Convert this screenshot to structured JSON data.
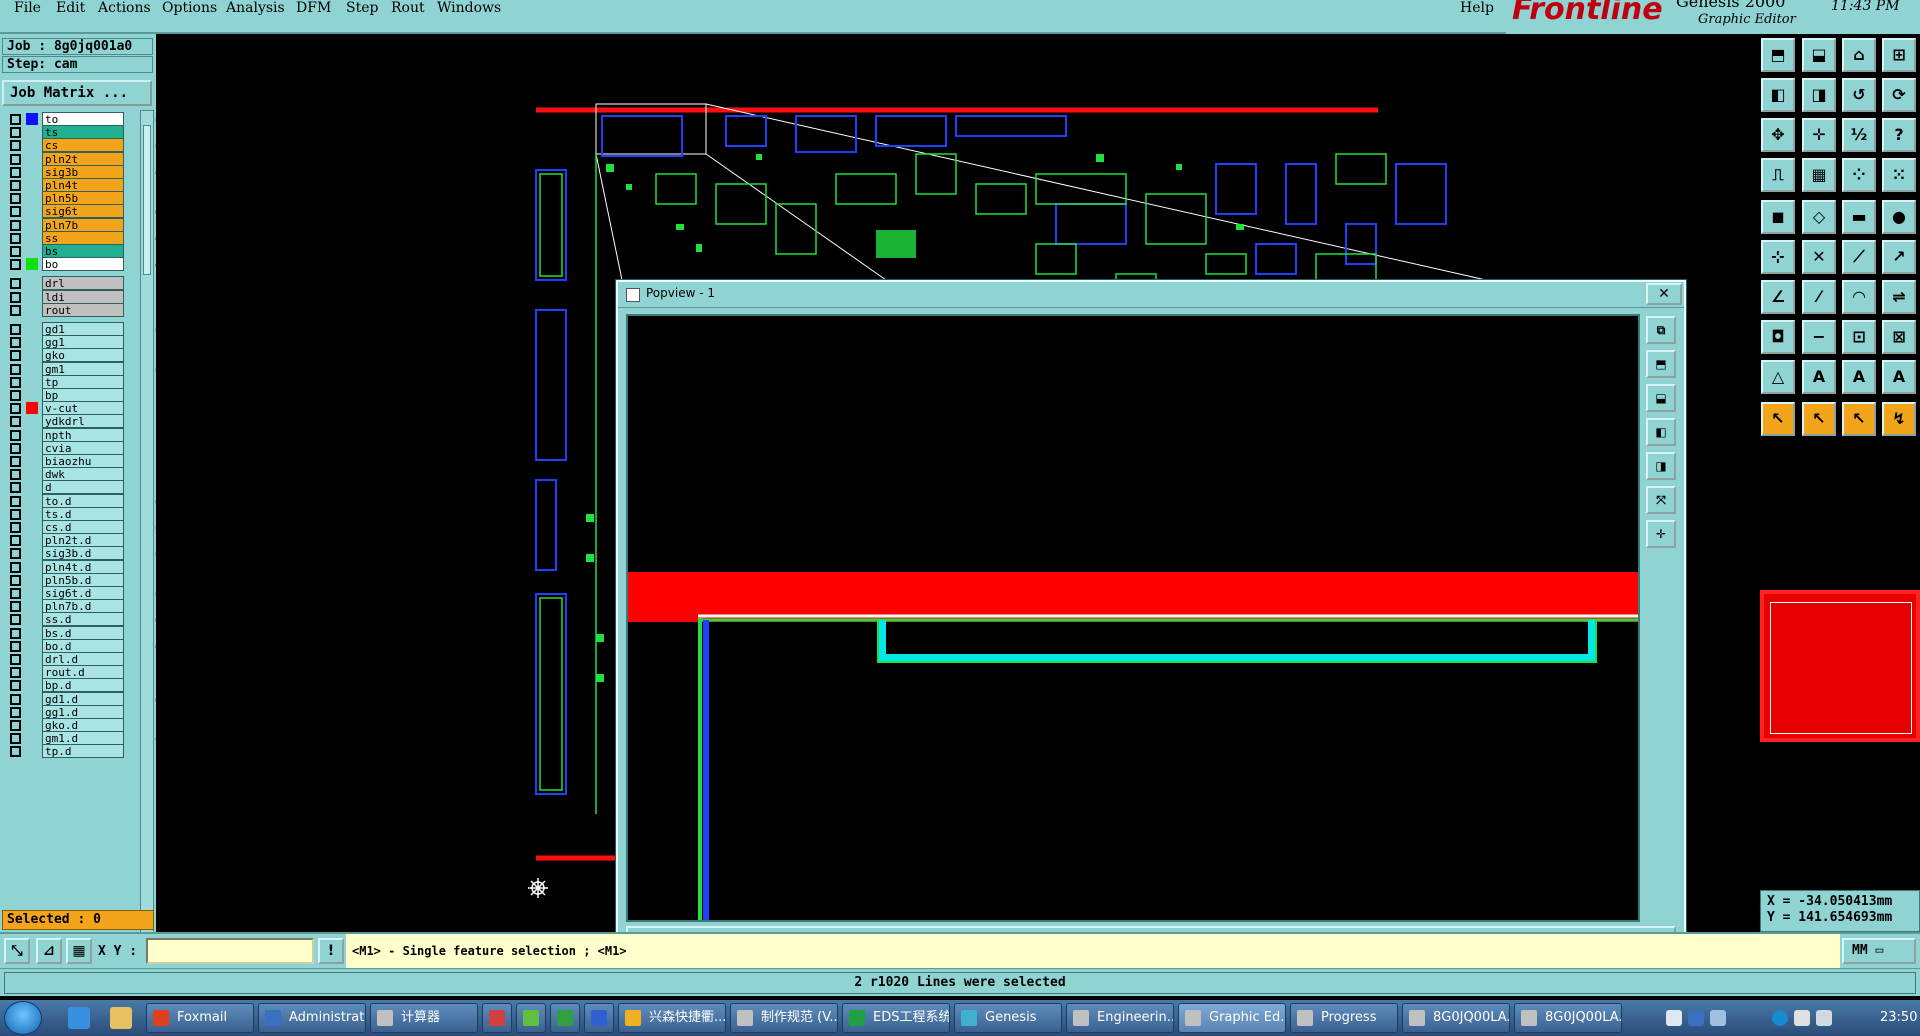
{
  "menu": {
    "items": [
      "File",
      "Edit",
      "Actions",
      "Options",
      "Analysis",
      "DFM",
      "Step",
      "Rout",
      "Windows"
    ],
    "help": "Help"
  },
  "brand": {
    "logo": "Frontline",
    "product": "Genesis 2000",
    "subtitle": "Graphic Editor",
    "time": "11:43 PM"
  },
  "job": {
    "job_label": "Job : 8g0jq001a0",
    "step_label": "Step: cam",
    "matrix_button": "Job Matrix ..."
  },
  "layers": [
    {
      "name": "to",
      "color": "#ffffff",
      "swatch": "#1010ff",
      "mark": "⬋"
    },
    {
      "name": "ts",
      "color": "#20b090",
      "swatch": "",
      "mark": ""
    },
    {
      "name": "cs",
      "color": "#f2a51a",
      "swatch": "",
      "mark": "⬋"
    },
    {
      "name": "pln2t",
      "color": "#f2a51a",
      "swatch": "",
      "mark": ""
    },
    {
      "name": "sig3b",
      "color": "#f2a51a",
      "swatch": "",
      "mark": "⬋"
    },
    {
      "name": "pln4t",
      "color": "#f2a51a",
      "swatch": "",
      "mark": ""
    },
    {
      "name": "pln5b",
      "color": "#f2a51a",
      "swatch": "",
      "mark": ""
    },
    {
      "name": "sig6t",
      "color": "#f2a51a",
      "swatch": "",
      "mark": "⬋"
    },
    {
      "name": "pln7b",
      "color": "#f2a51a",
      "swatch": "",
      "mark": ""
    },
    {
      "name": "ss",
      "color": "#f2a51a",
      "swatch": "",
      "mark": "⬋"
    },
    {
      "name": "bs",
      "color": "#20b090",
      "swatch": "",
      "mark": ""
    },
    {
      "name": "bo",
      "color": "#ffffff",
      "swatch": "#10e010",
      "mark": "⬋"
    },
    {
      "name": "drl",
      "color": "#c0c0c0",
      "swatch": "",
      "mark": ""
    },
    {
      "name": "ldi",
      "color": "#c0c0c0",
      "swatch": "",
      "mark": ""
    },
    {
      "name": "rout",
      "color": "#c0c0c0",
      "swatch": "",
      "mark": ""
    },
    {
      "name": "gd1",
      "color": "#a8e4e4",
      "swatch": "",
      "mark": "⬋"
    },
    {
      "name": "gg1",
      "color": "#a8e4e4",
      "swatch": "",
      "mark": ""
    },
    {
      "name": "gko",
      "color": "#a8e4e4",
      "swatch": "",
      "mark": ""
    },
    {
      "name": "gm1",
      "color": "#a8e4e4",
      "swatch": "",
      "mark": "⬋"
    },
    {
      "name": "tp",
      "color": "#a8e4e4",
      "swatch": "",
      "mark": ""
    },
    {
      "name": "bp",
      "color": "#a8e4e4",
      "swatch": "",
      "mark": ""
    },
    {
      "name": "v-cut",
      "color": "#a8e4e4",
      "swatch": "#ff0000",
      "mark": "▪"
    },
    {
      "name": "ydkdrl",
      "color": "#a8e4e4",
      "swatch": "",
      "mark": ""
    },
    {
      "name": "npth",
      "color": "#a8e4e4",
      "swatch": "",
      "mark": ""
    },
    {
      "name": "cvia",
      "color": "#a8e4e4",
      "swatch": "",
      "mark": ""
    },
    {
      "name": "biaozhu",
      "color": "#a8e4e4",
      "swatch": "",
      "mark": ""
    },
    {
      "name": "dwk",
      "color": "#a8e4e4",
      "swatch": "",
      "mark": ""
    },
    {
      "name": "d",
      "color": "#a8e4e4",
      "swatch": "",
      "mark": ""
    },
    {
      "name": "to.d",
      "color": "#a8e4e4",
      "swatch": "",
      "mark": "⬋"
    },
    {
      "name": "ts.d",
      "color": "#a8e4e4",
      "swatch": "",
      "mark": ""
    },
    {
      "name": "cs.d",
      "color": "#a8e4e4",
      "swatch": "",
      "mark": "⬋"
    },
    {
      "name": "pln2t.d",
      "color": "#a8e4e4",
      "swatch": "",
      "mark": ""
    },
    {
      "name": "sig3b.d",
      "color": "#a8e4e4",
      "swatch": "",
      "mark": "⬋"
    },
    {
      "name": "pln4t.d",
      "color": "#a8e4e4",
      "swatch": "",
      "mark": ""
    },
    {
      "name": "pln5b.d",
      "color": "#a8e4e4",
      "swatch": "",
      "mark": ""
    },
    {
      "name": "sig6t.d",
      "color": "#a8e4e4",
      "swatch": "",
      "mark": "⬋"
    },
    {
      "name": "pln7b.d",
      "color": "#a8e4e4",
      "swatch": "",
      "mark": ""
    },
    {
      "name": "ss.d",
      "color": "#a8e4e4",
      "swatch": "",
      "mark": "⬋"
    },
    {
      "name": "bs.d",
      "color": "#a8e4e4",
      "swatch": "",
      "mark": ""
    },
    {
      "name": "bo.d",
      "color": "#a8e4e4",
      "swatch": "",
      "mark": "⬋"
    },
    {
      "name": "drl.d",
      "color": "#a8e4e4",
      "swatch": "",
      "mark": ""
    },
    {
      "name": "rout.d",
      "color": "#a8e4e4",
      "swatch": "",
      "mark": ""
    },
    {
      "name": "bp.d",
      "color": "#a8e4e4",
      "swatch": "",
      "mark": ""
    },
    {
      "name": "gd1.d",
      "color": "#a8e4e4",
      "swatch": "",
      "mark": "⬋"
    },
    {
      "name": "gg1.d",
      "color": "#a8e4e4",
      "swatch": "",
      "mark": ""
    },
    {
      "name": "gko.d",
      "color": "#a8e4e4",
      "swatch": "",
      "mark": ""
    },
    {
      "name": "gm1.d",
      "color": "#a8e4e4",
      "swatch": "",
      "mark": "⬋"
    },
    {
      "name": "tp.d",
      "color": "#a8e4e4",
      "swatch": "",
      "mark": ""
    }
  ],
  "selected": "Selected : 0",
  "popview": {
    "title": "Popview - 1",
    "close_x": "✕",
    "close_button": "Close"
  },
  "command": {
    "xy_label": "X Y :",
    "xy_value": "",
    "hint": "<M1> - Single feature selection ; <M1>",
    "units": "MM ▭"
  },
  "status": "2 r1020 Lines were selected",
  "coords": {
    "x": "X = -34.050413mm",
    "y": "Y = 141.654693mm"
  },
  "taskbar": {
    "items": [
      "Foxmail",
      "Administrat...",
      "计算器",
      "",
      "",
      "",
      "",
      "兴森快捷衢...",
      "制作规范 (V...",
      "EDS工程系统",
      "Genesis",
      "Engineerin...",
      "Graphic Ed...",
      "Progress",
      "8G0JQ00LA...",
      "8G0JQ00LA..."
    ],
    "clock": "23:50"
  },
  "colors": {
    "accent": "#8fd3d3",
    "highlight": "#f2a51a",
    "red_layer": "#ff0000",
    "board_blue": "#2040ff",
    "board_green": "#20e040"
  }
}
